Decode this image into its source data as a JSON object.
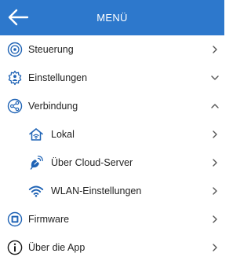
{
  "header": {
    "title": "MENÜ",
    "back_icon": "arrow-left-icon"
  },
  "menu": {
    "items": [
      {
        "label": "Steuerung",
        "icon": "target-icon",
        "chevron": "right"
      },
      {
        "label": "Einstellungen",
        "icon": "gear-person-icon",
        "chevron": "down"
      },
      {
        "label": "Verbindung",
        "icon": "share-icon",
        "chevron": "up",
        "expanded": true,
        "children": [
          {
            "label": "Lokal",
            "icon": "home-wifi-icon",
            "chevron": "right"
          },
          {
            "label": "Über Cloud-Server",
            "icon": "satellite-icon",
            "chevron": "right"
          },
          {
            "label": "WLAN-Einstellungen",
            "icon": "wifi-icon",
            "chevron": "right"
          }
        ]
      },
      {
        "label": "Firmware",
        "icon": "chip-icon",
        "chevron": "right"
      },
      {
        "label": "Über die App",
        "icon": "info-icon",
        "chevron": "right"
      }
    ]
  },
  "colors": {
    "header_bg": "#2d78cc",
    "icon_blue": "#1f63b5",
    "chevron": "#555555",
    "text": "#222222"
  }
}
